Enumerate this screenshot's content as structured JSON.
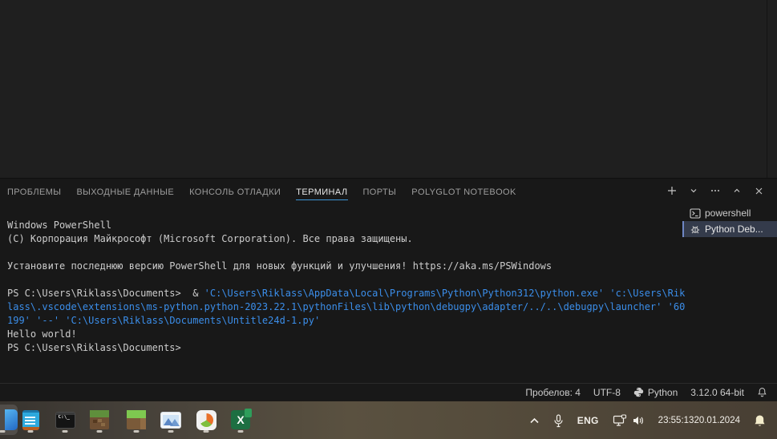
{
  "colors": {
    "editor_bg": "#1f1f1f",
    "panel_bg": "#181818",
    "tab_active_underline": "#3d95d6",
    "terminal_fg": "#cccccc",
    "terminal_path_blue": "#3b8eea",
    "selected_session_bg": "#343b4b",
    "taskbar_brown": "#5a5140"
  },
  "panel": {
    "tabs": [
      {
        "label": "ПРОБЛЕМЫ",
        "active": false
      },
      {
        "label": "ВЫХОДНЫЕ ДАННЫЕ",
        "active": false
      },
      {
        "label": "КОНСОЛЬ ОТЛАДКИ",
        "active": false
      },
      {
        "label": "ТЕРМИНАЛ",
        "active": true
      },
      {
        "label": "ПОРТЫ",
        "active": false
      },
      {
        "label": "POLYGLOT NOTEBOOK",
        "active": false
      }
    ],
    "actions": [
      {
        "name": "new-terminal-button",
        "icon": "plus-icon"
      },
      {
        "name": "terminal-profile-dropdown",
        "icon": "chevron-down-icon"
      },
      {
        "name": "more-actions-button",
        "icon": "ellipsis-icon"
      },
      {
        "name": "maximize-panel-button",
        "icon": "chevron-up-icon"
      },
      {
        "name": "close-panel-button",
        "icon": "close-icon"
      }
    ]
  },
  "terminal": {
    "lines": [
      {
        "segments": [
          {
            "t": "Windows PowerShell",
            "c": "fg"
          }
        ]
      },
      {
        "segments": [
          {
            "t": "(C) Корпорация Майкрософт (Microsoft Corporation). Все права защищены.",
            "c": "fg"
          }
        ]
      },
      {
        "segments": []
      },
      {
        "segments": [
          {
            "t": "Установите последнюю версию PowerShell для новых функций и улучшения! https://aka.ms/PSWindows",
            "c": "fg"
          }
        ]
      },
      {
        "segments": []
      },
      {
        "segments": [
          {
            "t": "PS C:\\Users\\Riklass\\Documents>  & ",
            "c": "fg"
          },
          {
            "t": "'C:\\Users\\Riklass\\AppData\\Local\\Programs\\Python\\Python312\\python.exe'",
            "c": "blue"
          },
          {
            "t": " ",
            "c": "fg"
          },
          {
            "t": "'c:\\Users\\Rik",
            "c": "blue"
          }
        ]
      },
      {
        "segments": [
          {
            "t": "lass\\.vscode\\extensions\\ms-python.python-2023.22.1\\pythonFiles\\lib\\python\\debugpy\\adapter/../..\\debugpy\\launcher'",
            "c": "blue"
          },
          {
            "t": " ",
            "c": "fg"
          },
          {
            "t": "'60",
            "c": "blue"
          }
        ]
      },
      {
        "segments": [
          {
            "t": "199'",
            "c": "blue"
          },
          {
            "t": " ",
            "c": "fg"
          },
          {
            "t": "'--'",
            "c": "blue"
          },
          {
            "t": " ",
            "c": "fg"
          },
          {
            "t": "'C:\\Users\\Riklass\\Documents\\Untitle24d-1.py'",
            "c": "blue"
          }
        ]
      },
      {
        "segments": [
          {
            "t": "Hello world!",
            "c": "fg"
          }
        ]
      },
      {
        "segments": [
          {
            "t": "PS C:\\Users\\Riklass\\Documents>",
            "c": "fg"
          }
        ]
      }
    ],
    "sessions": [
      {
        "label": "powershell",
        "icon": "terminal-icon",
        "selected": false
      },
      {
        "label": "Python Deb...",
        "icon": "debug-icon",
        "selected": true
      }
    ]
  },
  "statusbar": {
    "spaces": "Пробелов: 4",
    "encoding": "UTF-8",
    "language": "Python",
    "interpreter": "3.12.0 64-bit"
  },
  "taskbar": {
    "apps": [
      "pinned-app-partial",
      "notepad",
      "command-prompt",
      "minecraft",
      "minecraft-launcher",
      "photos",
      "app-swirl",
      "excel"
    ],
    "tray": {
      "language": "ENG",
      "time": "23:55:13",
      "date": "20.01.2024"
    }
  }
}
